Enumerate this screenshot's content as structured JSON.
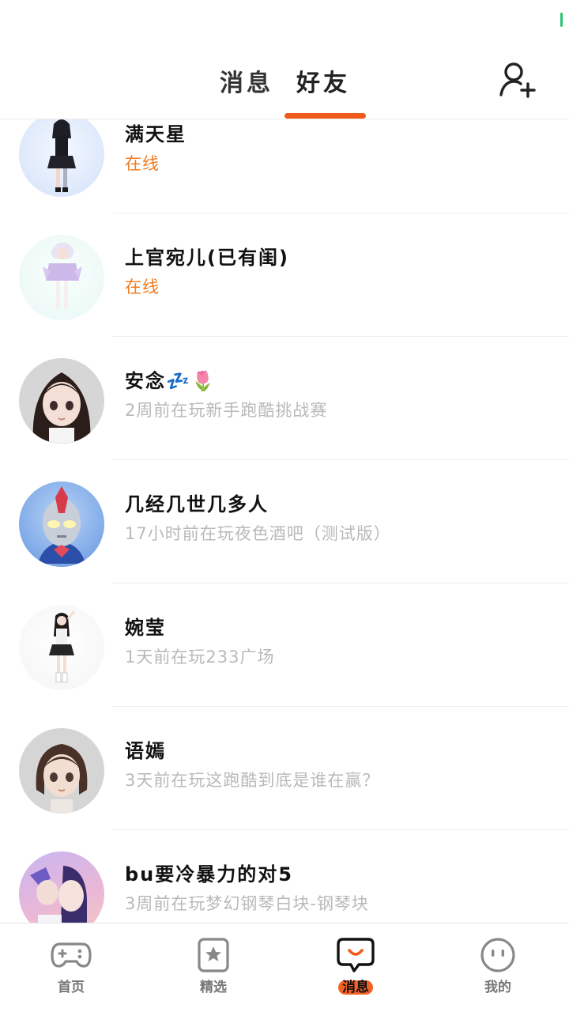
{
  "colors": {
    "accent": "#f05a1a",
    "online": "#f07c22",
    "muted": "#b9b9b9"
  },
  "header": {
    "tabs": [
      {
        "label": "消息",
        "active": false
      },
      {
        "label": "好友",
        "active": true
      }
    ],
    "add_friend_icon": "add-user-icon"
  },
  "friends": [
    {
      "name": "满天星",
      "status": "在线",
      "online": true
    },
    {
      "name": "上官宛儿(已有闺)",
      "status": "在线",
      "online": true
    },
    {
      "name": "安念",
      "status": "2周前在玩新手跑酷挑战赛",
      "online": false,
      "emoji": [
        "💤",
        "🌷"
      ]
    },
    {
      "name": "几经几世几多人",
      "status": "17小时前在玩夜色酒吧（测试版）",
      "online": false
    },
    {
      "name": "婉莹",
      "status": "1天前在玩233广场",
      "online": false
    },
    {
      "name": "语嫣",
      "status": "3天前在玩这跑酷到底是谁在赢？",
      "online": false
    },
    {
      "name": "bu要冷暴力的对5",
      "status": "3周前在玩梦幻钢琴白块-钢琴块",
      "online": false
    }
  ],
  "bottom_nav": [
    {
      "label": "首页",
      "icon": "gamepad-icon"
    },
    {
      "label": "精选",
      "icon": "star-bookmark-icon"
    },
    {
      "label": "消息",
      "icon": "chat-bubble-icon",
      "active": true
    },
    {
      "label": "我的",
      "icon": "face-icon"
    }
  ]
}
